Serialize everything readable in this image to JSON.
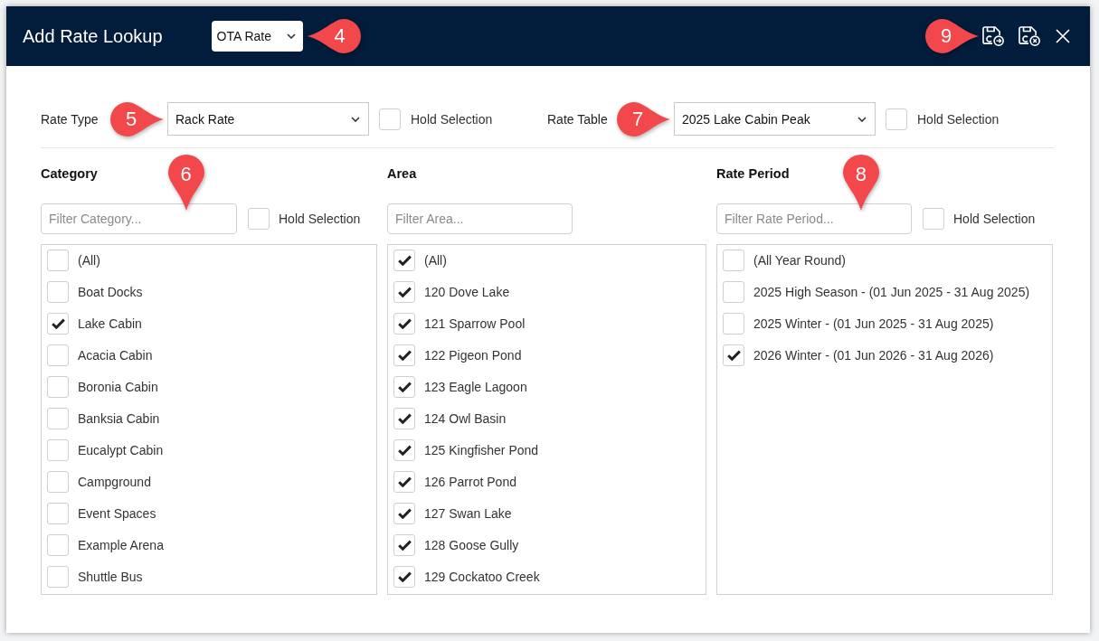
{
  "dialog": {
    "title": "Add Rate Lookup",
    "rate_source": {
      "value": "OTA Rate",
      "callout": {
        "label": "4",
        "kind": "left"
      }
    },
    "toolbar": [
      {
        "kind": "save-continue",
        "callout": {
          "label": "9",
          "kind": "right"
        }
      },
      {
        "kind": "save-close"
      },
      {
        "kind": "close"
      }
    ]
  },
  "filters": [
    {
      "label": "Rate Type",
      "value": "Rack Rate",
      "callout": {
        "label": "5",
        "kind": "right"
      },
      "hold_selection": {
        "label": "Hold Selection",
        "checked": false
      }
    },
    {
      "label": "Rate Table",
      "value": "2025 Lake Cabin Peak",
      "callout": {
        "label": "7",
        "kind": "right"
      },
      "hold_selection": {
        "label": "Hold Selection",
        "checked": false
      }
    }
  ],
  "lists": [
    {
      "heading": "Category",
      "filter": {
        "placeholder": "Filter Category...",
        "callout": {
          "label": "6",
          "kind": "down"
        }
      },
      "hold_selection": {
        "label": "Hold Selection",
        "checked": false
      },
      "items": [
        {
          "label": "(All)",
          "checked": false
        },
        {
          "label": "Boat Docks",
          "checked": false
        },
        {
          "label": "Lake Cabin",
          "checked": true
        },
        {
          "label": "Acacia Cabin",
          "checked": false
        },
        {
          "label": "Boronia Cabin",
          "checked": false
        },
        {
          "label": "Banksia Cabin",
          "checked": false
        },
        {
          "label": "Eucalypt Cabin",
          "checked": false
        },
        {
          "label": "Campground",
          "checked": false
        },
        {
          "label": "Event Spaces",
          "checked": false
        },
        {
          "label": "Example Arena",
          "checked": false
        },
        {
          "label": "Shuttle Bus",
          "checked": false
        }
      ]
    },
    {
      "heading": "Area",
      "filter": {
        "placeholder": "Filter Area..."
      },
      "items": [
        {
          "label": "(All)",
          "checked": true
        },
        {
          "label": "120 Dove Lake",
          "checked": true
        },
        {
          "label": "121 Sparrow Pool",
          "checked": true
        },
        {
          "label": "122 Pigeon Pond",
          "checked": true
        },
        {
          "label": "123 Eagle Lagoon",
          "checked": true
        },
        {
          "label": "124 Owl Basin",
          "checked": true
        },
        {
          "label": "125 Kingfisher Pond",
          "checked": true
        },
        {
          "label": "126 Parrot Pond",
          "checked": true
        },
        {
          "label": "127 Swan Lake",
          "checked": true
        },
        {
          "label": "128 Goose Gully",
          "checked": true
        },
        {
          "label": "129 Cockatoo Creek",
          "checked": true
        }
      ]
    },
    {
      "heading": "Rate Period",
      "filter": {
        "placeholder": "Filter Rate Period...",
        "callout": {
          "label": "8",
          "kind": "down"
        }
      },
      "hold_selection": {
        "label": "Hold Selection",
        "checked": false
      },
      "items": [
        {
          "label": "(All Year Round)",
          "checked": false
        },
        {
          "label": "2025 High Season - (01 Jun 2025 - 31 Aug 2025)",
          "checked": false
        },
        {
          "label": "2025 Winter - (01 Jun 2025 - 31 Aug 2025)",
          "checked": false
        },
        {
          "label": "2026 Winter - (01 Jun 2026 - 31 Aug 2026)",
          "checked": true
        }
      ]
    }
  ]
}
